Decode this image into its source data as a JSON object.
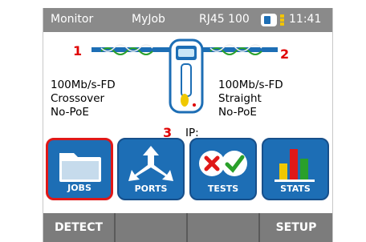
{
  "status_bar": {
    "mode": "Monitor",
    "job": "MyJob",
    "port": "RJ45 100",
    "time": "11:41"
  },
  "diagram": {
    "left": {
      "number": "1",
      "speed": "100Mb/s-FD",
      "wiring": "Crossover",
      "poe": "No-PoE"
    },
    "right": {
      "number": "2",
      "speed": "100Mb/s-FD",
      "wiring": "Straight",
      "poe": "No-PoE"
    },
    "ip": {
      "number": "3",
      "label": "IP:"
    }
  },
  "apps": [
    {
      "label": "JOBS",
      "icon": "folder-icon",
      "selected": true
    },
    {
      "label": "PORTS",
      "icon": "ports-arrows-icon",
      "selected": false
    },
    {
      "label": "TESTS",
      "icon": "tests-pass-fail-icon",
      "selected": false
    },
    {
      "label": "STATS",
      "icon": "bar-chart-icon",
      "selected": false
    }
  ],
  "softkeys": [
    "DETECT",
    "",
    "",
    "SETUP"
  ],
  "colors": {
    "accent_red": "#e00000",
    "button_blue": "#1d6eb5",
    "status_bar": "#8a8a8a",
    "softkey_bar": "#7c7c7c"
  }
}
